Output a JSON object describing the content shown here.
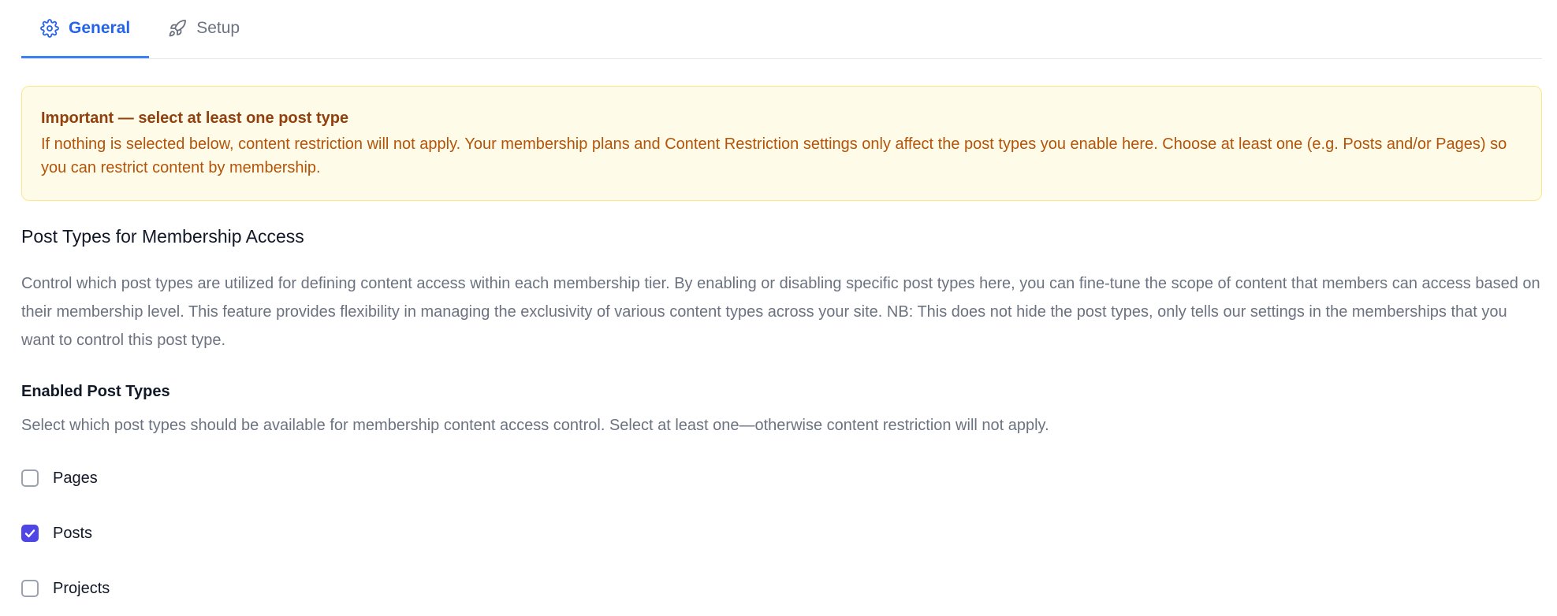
{
  "tabs": [
    {
      "label": "General",
      "icon": "gear-icon",
      "active": true
    },
    {
      "label": "Setup",
      "icon": "rocket-icon",
      "active": false
    }
  ],
  "notice": {
    "title": "Important — select at least one post type",
    "body": "If nothing is selected below, content restriction will not apply. Your membership plans and Content Restriction settings only affect the post types you enable here. Choose at least one (e.g. Posts and/or Pages) so you can restrict content by membership."
  },
  "section": {
    "title": "Post Types for Membership Access",
    "description": "Control which post types are utilized for defining content access within each membership tier. By enabling or disabling specific post types here, you can fine-tune the scope of content that members can access based on their membership level. This feature provides flexibility in managing the exclusivity of various content types across your site. NB: This does not hide the post types, only tells our settings in the memberships that you want to control this post type."
  },
  "enabled_post_types": {
    "label": "Enabled Post Types",
    "help": "Select which post types should be available for membership content access control. Select at least one—otherwise content restriction will not apply.",
    "options": [
      {
        "label": "Pages",
        "checked": false
      },
      {
        "label": "Posts",
        "checked": true
      },
      {
        "label": "Projects",
        "checked": false
      }
    ]
  },
  "colors": {
    "accent": "#2563eb",
    "checkbox_checked": "#4f46e5",
    "notice_bg": "#fefce8",
    "notice_text": "#b45309"
  }
}
